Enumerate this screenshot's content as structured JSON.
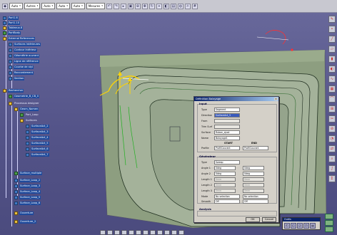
{
  "toolbar": {
    "sel1": "Auto",
    "sel2": "Autres",
    "sel3": "Auto",
    "sel4": "Auto",
    "sel5": "Auto",
    "sel6": "Mesures",
    "icons": [
      "undo-icon",
      "redo-icon",
      "select-icon",
      "fit-icon",
      "zoom-icon",
      "pan-icon",
      "rotate-icon",
      "measure-icon",
      "view-icon"
    ]
  },
  "tree": {
    "items": [
      "Part1.6",
      "Part1.10",
      "Tableaux.8",
      "PartBody",
      "External References",
      "Surfaces Intérieures",
      "Contour Intérieur",
      "Géométrie ouvrant",
      "Ligne de référence",
      "Courbe de styl",
      "Raccordement",
      "Section",
      "Rechercher",
      "Geometrie_B_CB_0",
      "Processus designer",
      "Geom_Nomen",
      "Part_Loop",
      "Surfaces",
      "SurfaceAct_2",
      "SurfaceAct_3",
      "SurfaceAct_4",
      "SurfaceAct_5",
      "SurfaceAct_6",
      "SurfaceAct_7",
      "Surface_multiple",
      "Surface_Loop_2",
      "Surface_Loop_3",
      "Surface_Loop_4",
      "Surface_Loop_5",
      "Surface_Loop_6",
      "Ouverture",
      "Ouverture_2"
    ]
  },
  "dialog": {
    "title": "Définition Balayage",
    "section_input": "Input",
    "type_label": "Type",
    "type_value": "Segment",
    "direction_label": "Direction",
    "direction_value": "SurfaceAct_3",
    "from_label": "From",
    "from_value": "",
    "trim_label": "Trim Surf",
    "trim_value": "",
    "surface_label": "Surface",
    "surface_value": "Ruban_ajust",
    "name_label": "Name",
    "name_value": "Balayage1",
    "start_label": "START",
    "end_label": "END",
    "gen_label": "Profile",
    "gen_start": "ProfilCourant",
    "gen_end": "ProfilCourant",
    "section_generator": "Générateur",
    "guide_type_label": "Type",
    "guide_type_value": "Sweep",
    "angle1_label": "Angle 1",
    "angle1_value": "0deg",
    "angle2_label": "Angle 2",
    "angle2_value": "0deg",
    "length1_label": "Length 1",
    "length1_value": "0mm",
    "length2_label": "Length 2",
    "length2_value": "0mm",
    "length3_label": "Length 3",
    "length3_value": "0mm",
    "mode_label": "Mode",
    "mode_start": "No selection",
    "mode_end": "No selection",
    "smooth_label": "Smooth",
    "smooth_start": "Off",
    "smooth_end": "Off",
    "section_analysis": "Analysis",
    "ok_label": "OK",
    "cancel_label": "Cancel"
  },
  "palette": {
    "title": "Outils",
    "icons": [
      "a",
      "b",
      "c",
      "d",
      "e"
    ]
  },
  "viewport": {
    "model_color": "#8d9e80",
    "highlight_color": "#ffd400"
  }
}
